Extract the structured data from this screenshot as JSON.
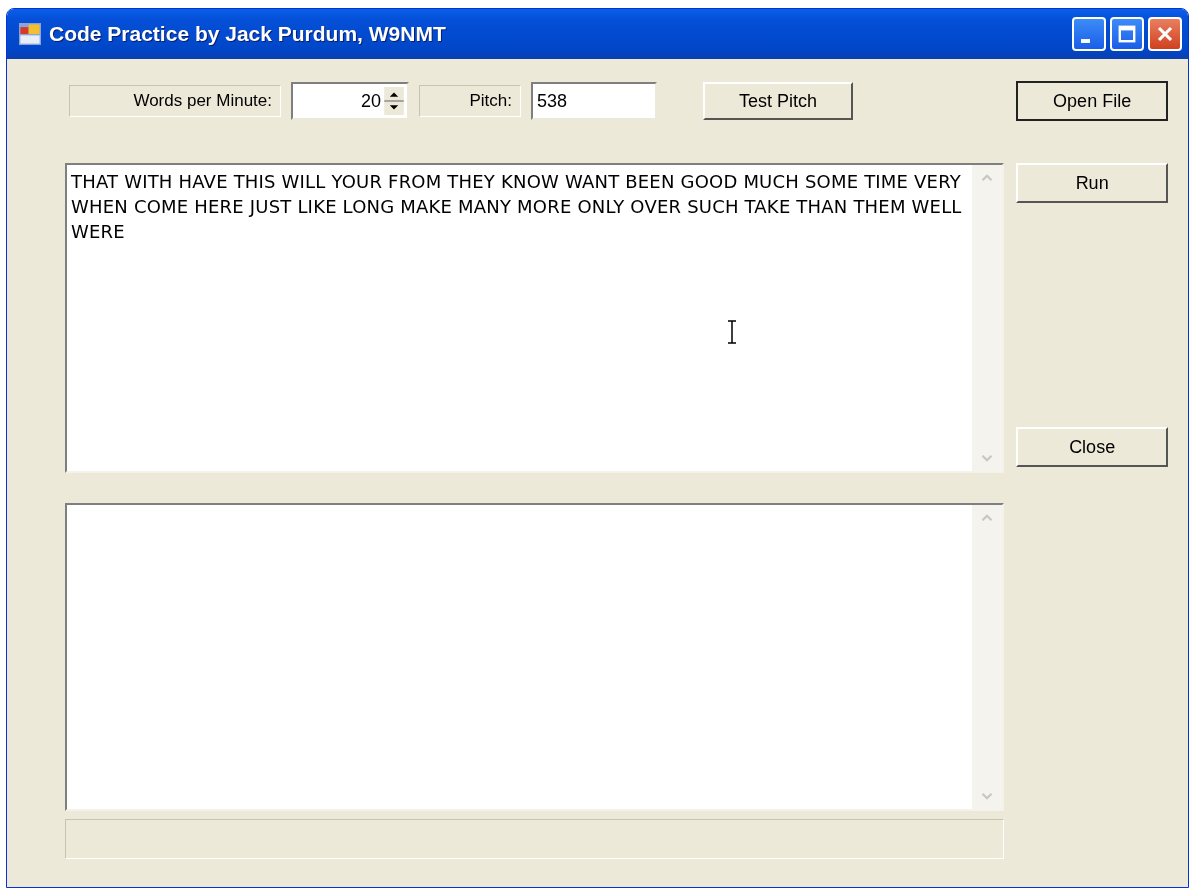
{
  "window": {
    "title": "Code Practice by Jack Purdum, W9NMT"
  },
  "speed": {
    "label": "Words per Minute:",
    "value": "20"
  },
  "pitch": {
    "label": "Pitch:",
    "value": "538"
  },
  "test_pitch_button": {
    "label": "Test Pitch",
    "focused": false
  },
  "open_file_button": {
    "label": "Open File",
    "focused": true
  },
  "run_button": {
    "label": "Run",
    "focused": false
  },
  "close_button": {
    "label": "Close",
    "focused": false
  },
  "input_text": {
    "value": "THAT WITH HAVE THIS WILL YOUR FROM THEY KNOW WANT BEEN GOOD MUCH SOME TIME VERY WHEN COME HERE JUST LIKE LONG MAKE MANY MORE ONLY OVER SUCH TAKE THAN THEM WELL WERE"
  }
}
